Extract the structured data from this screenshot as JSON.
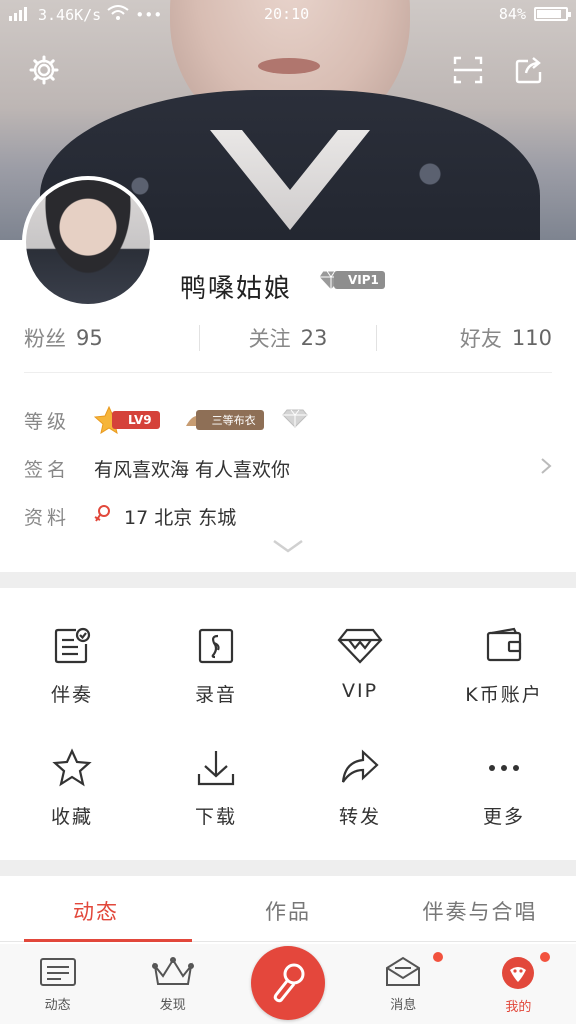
{
  "status_bar": {
    "speed": "3.46K/s",
    "time": "20:10",
    "battery": "84%",
    "battery_level": 0.84,
    "more": "•••"
  },
  "header": {
    "settings_icon": "gear-icon",
    "scan_icon": "scan-icon",
    "share_icon": "share-icon"
  },
  "profile": {
    "nickname": "鸭嗓姑娘",
    "vip_badge": "VIP1",
    "stats": {
      "fans_label": "粉丝",
      "fans_value": "95",
      "follow_label": "关注",
      "follow_value": "23",
      "friends_label": "好友",
      "friends_value": "110"
    },
    "level_label": "等级",
    "level_badge": "LV9",
    "cloth_badge": "三等布衣",
    "signature_label": "签名",
    "signature": "有风喜欢海 有人喜欢你",
    "profile_label": "资料",
    "profile_info": "17 北京 东城"
  },
  "grid": [
    {
      "label": "伴奏",
      "icon": "accompaniment-icon"
    },
    {
      "label": "录音",
      "icon": "recording-icon"
    },
    {
      "label": "VIP",
      "icon": "vip-diamond-icon"
    },
    {
      "label": "K币账户",
      "icon": "wallet-icon"
    },
    {
      "label": "收藏",
      "icon": "star-icon"
    },
    {
      "label": "下载",
      "icon": "download-icon"
    },
    {
      "label": "转发",
      "icon": "forward-icon"
    },
    {
      "label": "更多",
      "icon": "more-icon"
    }
  ],
  "tabs": [
    {
      "label": "动态",
      "active": true
    },
    {
      "label": "作品",
      "active": false
    },
    {
      "label": "伴奏与合唱",
      "active": false
    }
  ],
  "bottom_nav": [
    {
      "label": "动态",
      "icon": "feed-icon"
    },
    {
      "label": "发现",
      "icon": "crown-icon"
    },
    {
      "label": "",
      "icon": "microphone-icon"
    },
    {
      "label": "消息",
      "icon": "message-icon",
      "dot": true
    },
    {
      "label": "我的",
      "icon": "profile-icon",
      "dot": true,
      "active": true
    }
  ],
  "colors": {
    "accent": "#e2483b",
    "level_red": "#d5423a",
    "cloth_brown": "#8e6f56"
  }
}
